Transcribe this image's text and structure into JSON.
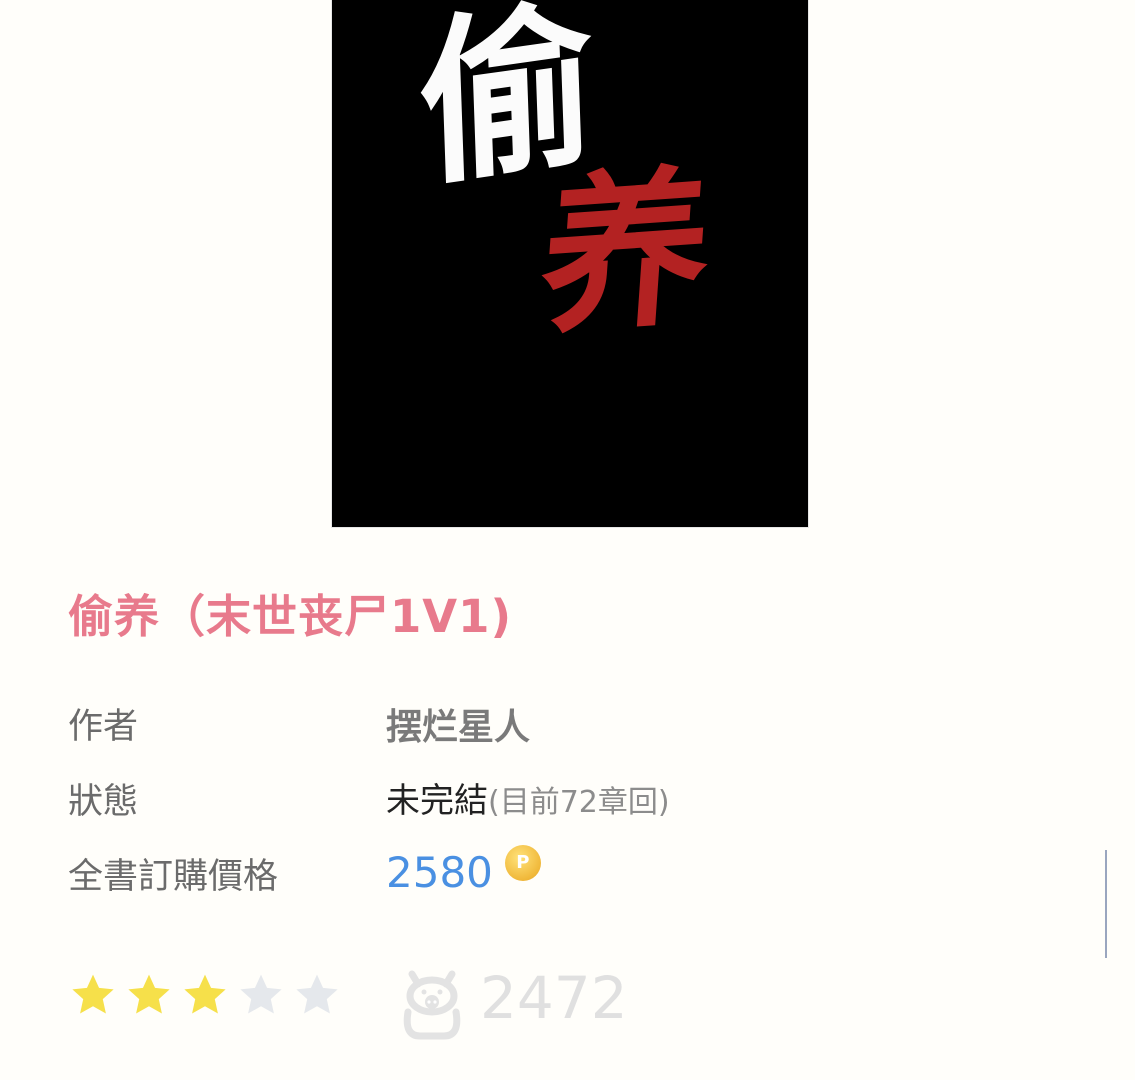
{
  "book": {
    "cover": {
      "char_1": "偷",
      "char_2": "养",
      "char_1_color": "#fbfbfb",
      "char_2_color": "#b32222",
      "background": "#000000"
    },
    "title": "偷养（末世丧尸1V1)",
    "info": {
      "author_label": "作者",
      "author_value": "摆烂星人",
      "status_label": "狀態",
      "status_value": "未完結",
      "status_detail": "(目前72章回)",
      "price_label": "全書訂購價格",
      "price_value": "2580",
      "coin_symbol": "P"
    },
    "rating": {
      "stars_filled": 3,
      "stars_total": 5,
      "filled_color": "#f6e04a",
      "empty_color": "#e5e8ec"
    },
    "bookmark": {
      "icon": "piggy-bank-icon",
      "count": "2472"
    },
    "colors": {
      "title": "#e87a8c",
      "price": "#4a90e2"
    }
  }
}
